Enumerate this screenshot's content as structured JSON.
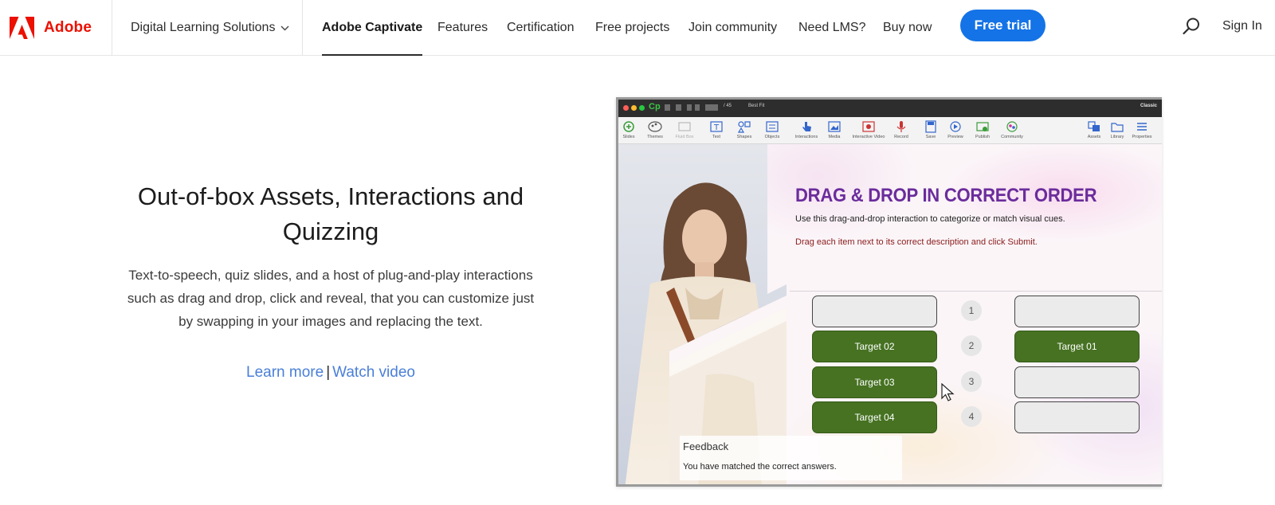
{
  "nav": {
    "brand": "Adobe",
    "dls_label": "Digital Learning Solutions",
    "links": [
      "Adobe Captivate",
      "Features",
      "Certification",
      "Free projects",
      "Join community",
      "Need LMS?",
      "Buy now"
    ],
    "cta": "Free trial",
    "sign_in": "Sign In"
  },
  "hero": {
    "title": "Out-of-box Assets, Interactions and Quizzing",
    "body": "Text-to-speech, quiz slides, and a host of plug-and-play interactions such as drag and drop, click and reveal, that you can customize just by swapping in your images and replacing the text.",
    "learn_more": "Learn more",
    "separator": "|",
    "watch_video": "Watch video"
  },
  "captivate": {
    "app_logo": "Cp",
    "zoom": "Best Fit",
    "page_of": "/ 45",
    "mode": "Classic",
    "toolbar": [
      "Slides",
      "Themes",
      "Fluid Box",
      "Text",
      "Shapes",
      "Objects",
      "Interactions",
      "Media",
      "Interactive Video",
      "Record",
      "Save",
      "Preview",
      "Publish",
      "Community",
      "Assets",
      "Library",
      "Properties"
    ],
    "slide": {
      "title": "DRAG & DROP IN CORRECT ORDER",
      "subtitle": "Use this drag-and-drop interaction to categorize or match visual cues.",
      "instruction": "Drag each item next to its correct description and click Submit.",
      "numbers": [
        "1",
        "2",
        "3",
        "4"
      ],
      "left_targets": [
        "",
        "Target 02",
        "Target 03",
        "Target 04"
      ],
      "right_targets": [
        "",
        "Target 01",
        "",
        ""
      ],
      "feedback_title": "Feedback",
      "feedback_text": "You have matched the correct answers."
    }
  },
  "colors": {
    "adobe_red": "#eb1000",
    "cta_blue": "#1473e6",
    "link_blue": "#4a7fd7",
    "slide_title": "#6b2c9c",
    "target_green": "#467222"
  }
}
